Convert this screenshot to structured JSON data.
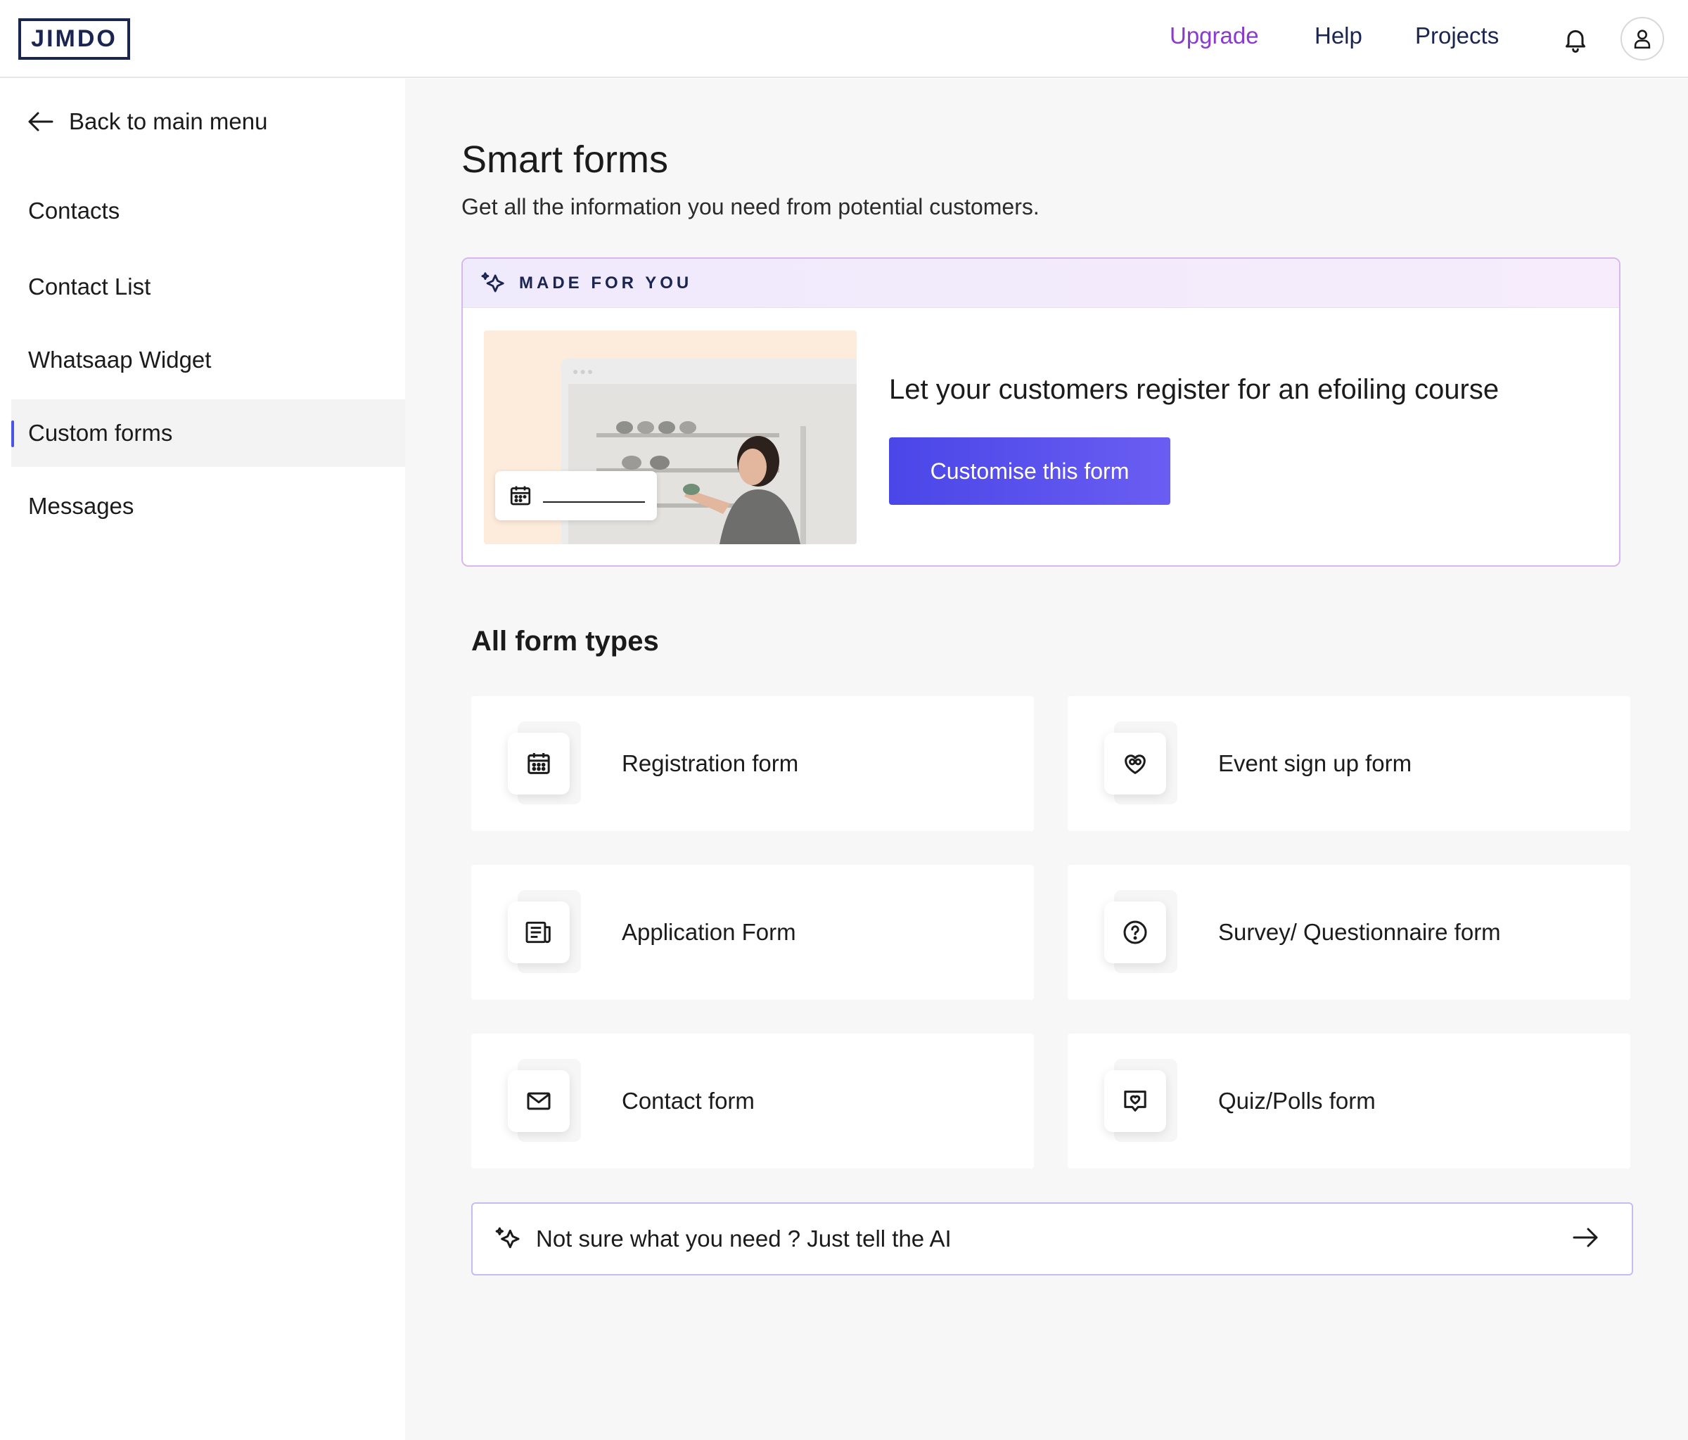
{
  "header": {
    "logo": "JIMDO",
    "nav": {
      "upgrade": "Upgrade",
      "help": "Help",
      "projects": "Projects"
    },
    "icons": {
      "notifications": "bell-icon",
      "account": "user-icon"
    }
  },
  "sidebar": {
    "back_label": "Back to main menu",
    "items": [
      {
        "label": "Contacts",
        "active": false
      },
      {
        "label": "Contact List",
        "active": false
      },
      {
        "label": "Whatsaap Widget",
        "active": false
      },
      {
        "label": "Custom forms",
        "active": true
      },
      {
        "label": "Messages",
        "active": false
      }
    ]
  },
  "main": {
    "title": "Smart forms",
    "subtitle": "Get all the information you need from potential customers.",
    "made_for_you": {
      "tag": "MADE FOR YOU",
      "headline": "Let your customers register for an efoiling course",
      "cta_label": "Customise this form"
    },
    "section_title": "All form types",
    "form_types": [
      {
        "label": "Registration form",
        "icon": "calendar-icon"
      },
      {
        "label": "Event sign up form",
        "icon": "heart-people-icon"
      },
      {
        "label": "Application Form",
        "icon": "document-icon"
      },
      {
        "label": "Survey/ Questionnaire form",
        "icon": "question-icon"
      },
      {
        "label": "Contact form",
        "icon": "mail-icon"
      },
      {
        "label": "Quiz/Polls form",
        "icon": "chat-heart-icon"
      }
    ],
    "ai_prompt": {
      "label": "Not sure what you need ? Just tell the AI"
    }
  },
  "colors": {
    "accent": "#4a46e8",
    "upgrade": "#8a3ad1",
    "navy": "#1a2552",
    "active_marker": "#4a55e8"
  }
}
